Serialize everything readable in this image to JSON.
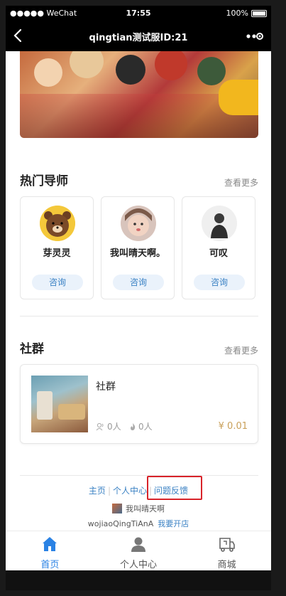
{
  "status_bar": {
    "carrier": "●●●●● WeChat",
    "time": "17:55",
    "battery": "100%"
  },
  "nav": {
    "title": "qingtian测试服ID:21"
  },
  "mentors_section": {
    "title": "热门导师",
    "see_more": "查看更多",
    "mentors": [
      {
        "name": "芽灵灵",
        "button": "咨询"
      },
      {
        "name": "我叫晴天啊。",
        "button": "咨询"
      },
      {
        "name": "可叹",
        "button": "咨询"
      }
    ]
  },
  "community_section": {
    "title": "社群",
    "see_more": "查看更多",
    "card": {
      "name": "社群",
      "members": "0人",
      "posts": "0人",
      "price": "¥ 0.01"
    }
  },
  "footer": {
    "links": [
      "主页",
      "个人中心",
      "问题反馈"
    ],
    "username": "我叫晴天啊",
    "account": "wojiaoQingTiAnA",
    "open_shop": "我要开店"
  },
  "tabbar": {
    "tabs": [
      {
        "label": "首页",
        "icon": "home-icon",
        "active": true
      },
      {
        "label": "个人中心",
        "icon": "person-icon",
        "active": false
      },
      {
        "label": "商城",
        "icon": "shop-cart-icon",
        "active": false
      }
    ],
    "active_color": "#2a82e4"
  }
}
